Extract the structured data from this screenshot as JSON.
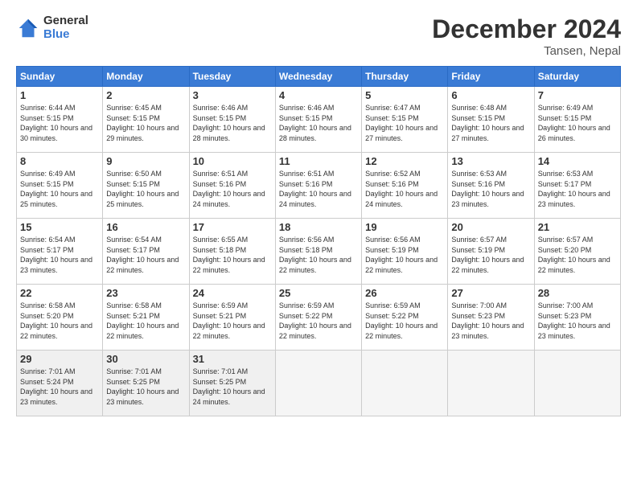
{
  "logo": {
    "general": "General",
    "blue": "Blue"
  },
  "title": "December 2024",
  "location": "Tansen, Nepal",
  "days_of_week": [
    "Sunday",
    "Monday",
    "Tuesday",
    "Wednesday",
    "Thursday",
    "Friday",
    "Saturday"
  ],
  "weeks": [
    [
      {
        "num": "1",
        "rise": "6:44 AM",
        "set": "5:15 PM",
        "daylight": "10 hours and 30 minutes."
      },
      {
        "num": "2",
        "rise": "6:45 AM",
        "set": "5:15 PM",
        "daylight": "10 hours and 29 minutes."
      },
      {
        "num": "3",
        "rise": "6:46 AM",
        "set": "5:15 PM",
        "daylight": "10 hours and 28 minutes."
      },
      {
        "num": "4",
        "rise": "6:46 AM",
        "set": "5:15 PM",
        "daylight": "10 hours and 28 minutes."
      },
      {
        "num": "5",
        "rise": "6:47 AM",
        "set": "5:15 PM",
        "daylight": "10 hours and 27 minutes."
      },
      {
        "num": "6",
        "rise": "6:48 AM",
        "set": "5:15 PM",
        "daylight": "10 hours and 27 minutes."
      },
      {
        "num": "7",
        "rise": "6:49 AM",
        "set": "5:15 PM",
        "daylight": "10 hours and 26 minutes."
      }
    ],
    [
      {
        "num": "8",
        "rise": "6:49 AM",
        "set": "5:15 PM",
        "daylight": "10 hours and 25 minutes."
      },
      {
        "num": "9",
        "rise": "6:50 AM",
        "set": "5:15 PM",
        "daylight": "10 hours and 25 minutes."
      },
      {
        "num": "10",
        "rise": "6:51 AM",
        "set": "5:16 PM",
        "daylight": "10 hours and 24 minutes."
      },
      {
        "num": "11",
        "rise": "6:51 AM",
        "set": "5:16 PM",
        "daylight": "10 hours and 24 minutes."
      },
      {
        "num": "12",
        "rise": "6:52 AM",
        "set": "5:16 PM",
        "daylight": "10 hours and 24 minutes."
      },
      {
        "num": "13",
        "rise": "6:53 AM",
        "set": "5:16 PM",
        "daylight": "10 hours and 23 minutes."
      },
      {
        "num": "14",
        "rise": "6:53 AM",
        "set": "5:17 PM",
        "daylight": "10 hours and 23 minutes."
      }
    ],
    [
      {
        "num": "15",
        "rise": "6:54 AM",
        "set": "5:17 PM",
        "daylight": "10 hours and 23 minutes."
      },
      {
        "num": "16",
        "rise": "6:54 AM",
        "set": "5:17 PM",
        "daylight": "10 hours and 22 minutes."
      },
      {
        "num": "17",
        "rise": "6:55 AM",
        "set": "5:18 PM",
        "daylight": "10 hours and 22 minutes."
      },
      {
        "num": "18",
        "rise": "6:56 AM",
        "set": "5:18 PM",
        "daylight": "10 hours and 22 minutes."
      },
      {
        "num": "19",
        "rise": "6:56 AM",
        "set": "5:19 PM",
        "daylight": "10 hours and 22 minutes."
      },
      {
        "num": "20",
        "rise": "6:57 AM",
        "set": "5:19 PM",
        "daylight": "10 hours and 22 minutes."
      },
      {
        "num": "21",
        "rise": "6:57 AM",
        "set": "5:20 PM",
        "daylight": "10 hours and 22 minutes."
      }
    ],
    [
      {
        "num": "22",
        "rise": "6:58 AM",
        "set": "5:20 PM",
        "daylight": "10 hours and 22 minutes."
      },
      {
        "num": "23",
        "rise": "6:58 AM",
        "set": "5:21 PM",
        "daylight": "10 hours and 22 minutes."
      },
      {
        "num": "24",
        "rise": "6:59 AM",
        "set": "5:21 PM",
        "daylight": "10 hours and 22 minutes."
      },
      {
        "num": "25",
        "rise": "6:59 AM",
        "set": "5:22 PM",
        "daylight": "10 hours and 22 minutes."
      },
      {
        "num": "26",
        "rise": "6:59 AM",
        "set": "5:22 PM",
        "daylight": "10 hours and 22 minutes."
      },
      {
        "num": "27",
        "rise": "7:00 AM",
        "set": "5:23 PM",
        "daylight": "10 hours and 23 minutes."
      },
      {
        "num": "28",
        "rise": "7:00 AM",
        "set": "5:23 PM",
        "daylight": "10 hours and 23 minutes."
      }
    ],
    [
      {
        "num": "29",
        "rise": "7:01 AM",
        "set": "5:24 PM",
        "daylight": "10 hours and 23 minutes."
      },
      {
        "num": "30",
        "rise": "7:01 AM",
        "set": "5:25 PM",
        "daylight": "10 hours and 23 minutes."
      },
      {
        "num": "31",
        "rise": "7:01 AM",
        "set": "5:25 PM",
        "daylight": "10 hours and 24 minutes."
      },
      null,
      null,
      null,
      null
    ]
  ]
}
